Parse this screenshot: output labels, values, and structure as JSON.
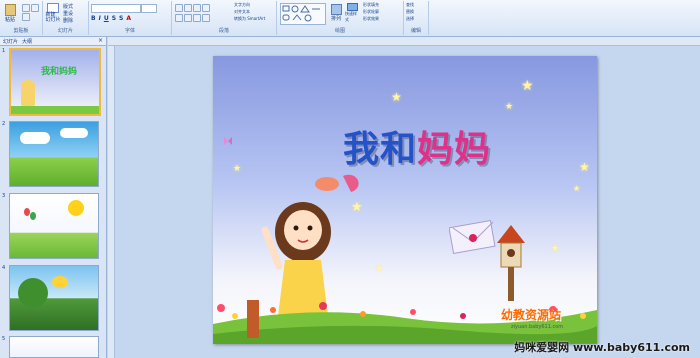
{
  "ribbon": {
    "groups": [
      "剪贴板",
      "幻灯片",
      "字体",
      "段落",
      "绘图",
      "编辑"
    ],
    "buttons": {
      "paste": "粘贴",
      "new_slide": "新建\n幻灯片",
      "layout": "版式",
      "reset": "重设",
      "delete": "删除",
      "text_direction": "文字方向",
      "align_text": "对齐文本",
      "smartart": "转换为 SmartArt",
      "arrange": "排列",
      "quick_styles": "快速样式",
      "shape_fill": "形状填充",
      "shape_outline": "形状轮廓",
      "shape_effects": "形状效果",
      "find": "查找",
      "replace": "替换",
      "select": "选择"
    }
  },
  "panel": {
    "tabs": [
      "幻灯片",
      "大纲"
    ],
    "thumbnails": [
      {
        "num": "1",
        "title": "我和妈妈"
      },
      {
        "num": "2",
        "title": ""
      },
      {
        "num": "3",
        "title": ""
      },
      {
        "num": "4",
        "title": ""
      },
      {
        "num": "5",
        "title": ""
      }
    ]
  },
  "slide": {
    "title_parts": [
      "我和",
      "妈妈"
    ],
    "title_colors": [
      "#2452c8",
      "#2fb84a",
      "#e0318a",
      "#7a3fb8"
    ],
    "logo_text": "幼教资源站",
    "logo_url": "ziyuan.baby611.com"
  },
  "watermark": "妈咪爱婴网 www.baby611.com"
}
